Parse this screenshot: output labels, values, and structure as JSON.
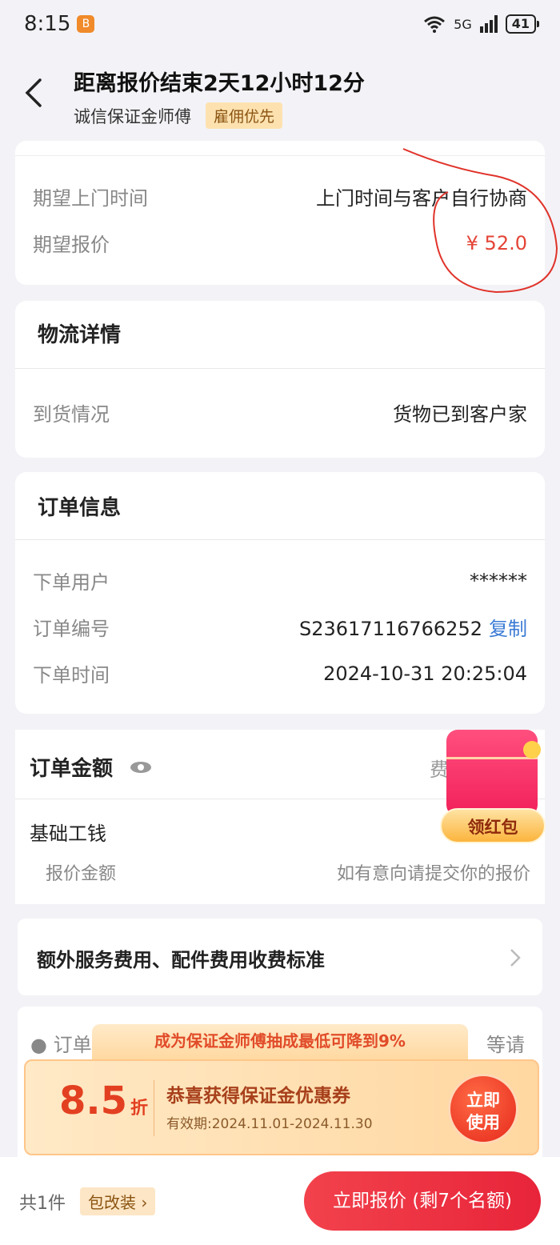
{
  "status_bar": {
    "time": "8:15",
    "app_badge": "B",
    "network": "5G",
    "battery": "41"
  },
  "header": {
    "title": "距离报价结束2天12小时12分",
    "subtitle": "诚信保证金师傅",
    "tag": "雇佣优先"
  },
  "appointment": {
    "rows": [
      {
        "label": "期望上门时间",
        "value": "上门时间与客户自行协商"
      },
      {
        "label": "期望报价",
        "value": "¥ 52.0"
      }
    ]
  },
  "logistics": {
    "title": "物流详情",
    "rows": [
      {
        "label": "到货情况",
        "value": "货物已到客户家"
      }
    ]
  },
  "order_info": {
    "title": "订单信息",
    "rows": [
      {
        "label": "下单用户",
        "value": "******"
      },
      {
        "label": "订单编号",
        "value": "S23617116766252"
      },
      {
        "label": "下单时间",
        "value": "2024-10-31 20:25:04"
      }
    ],
    "copy_label": "复制"
  },
  "order_amount": {
    "title": "订单金额",
    "fee_label": "费",
    "base_label": "基础工钱",
    "quote_label": "报价金额",
    "quote_hint": "如有意向请提交你的报价"
  },
  "red_packet": {
    "label": "领红包"
  },
  "standard": {
    "label": "额外服务费用、配件费用收费标准"
  },
  "note": {
    "text_left": "订单",
    "text_right": "等请"
  },
  "coupon": {
    "banner": "成为保证金师傅抽成最低可降到9%",
    "discount": "8.5",
    "discount_unit": "折",
    "title": "恭喜获得保证金优惠券",
    "validity": "有效期:2024.11.01-2024.11.30",
    "button_line1": "立即",
    "button_line2": "使用"
  },
  "bottom_bar": {
    "count": "共1件",
    "package_tag": "包改装",
    "quote_button": "立即报价 (剩7个名额)"
  },
  "colors": {
    "price": "#e44436",
    "link": "#3a7bd5",
    "primary": "#e8243a"
  }
}
